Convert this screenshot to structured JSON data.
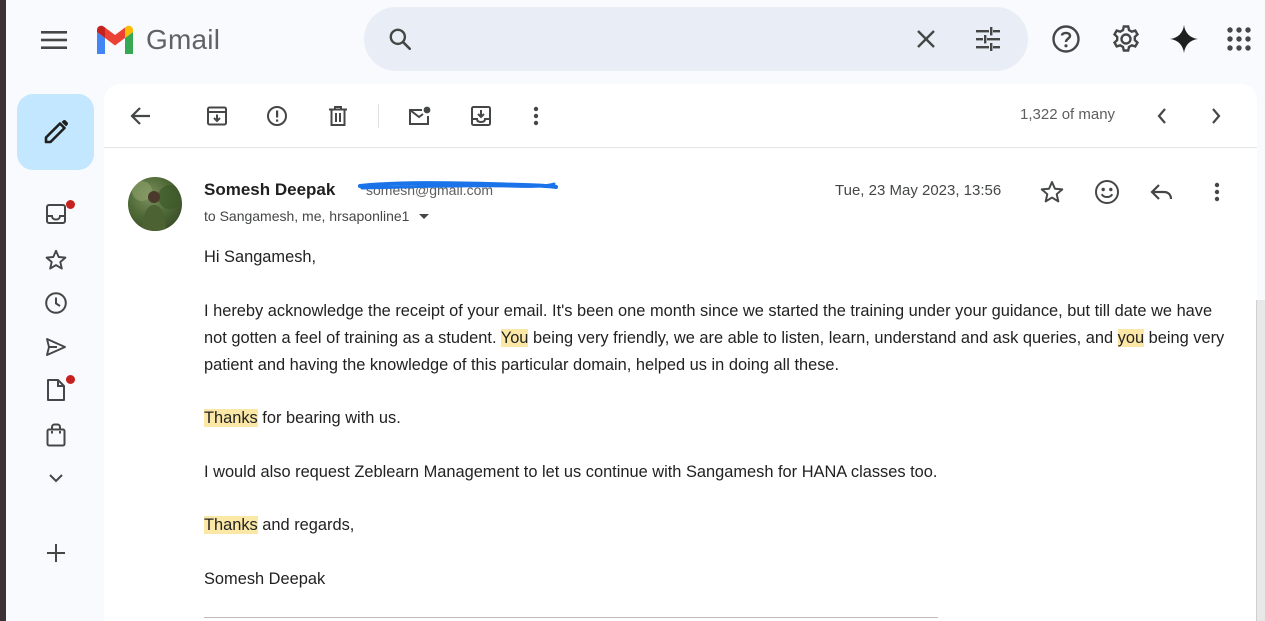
{
  "header": {
    "app_name": "Gmail",
    "search_placeholder": "",
    "icons": [
      "menu-icon",
      "help-icon",
      "settings-icon",
      "gemini-icon",
      "apps-icon"
    ]
  },
  "toolbar": {
    "counter": "1,322 of many"
  },
  "message": {
    "sender_name": "Somesh Deepak",
    "sender_email": "somesh@gmail.com",
    "recipients": "to Sangamesh, me, hrsaponline1",
    "date": "Tue, 23 May 2023, 13:56",
    "body": {
      "greeting": "Hi Sangamesh,",
      "p1_a": "I hereby acknowledge the receipt of your email. It's been one month since we started the training under your guidance, but till date we have not gotten a feel of training as a student. ",
      "p1_hl1": "You",
      "p1_b": " being very friendly, we are able to listen, learn, understand and ask queries, and ",
      "p1_hl2": "you",
      "p1_c": " being very patient and having the knowledge of this particular domain, helped us in doing all these.",
      "p2_hl": "Thanks",
      "p2_rest": " for bearing with us.",
      "p3": "I would also request Zeblearn Management to let us continue with Sangamesh for HANA classes too.",
      "p4_hl": "Thanks",
      "p4_rest": " and regards,",
      "signature": "Somesh Deepak"
    }
  },
  "colors": {
    "compose_bg": "#c2e7ff",
    "search_bg": "#e9eef6",
    "highlight": "#fce8a6",
    "badge": "#c5221f",
    "scribble": "#1a73e8"
  }
}
